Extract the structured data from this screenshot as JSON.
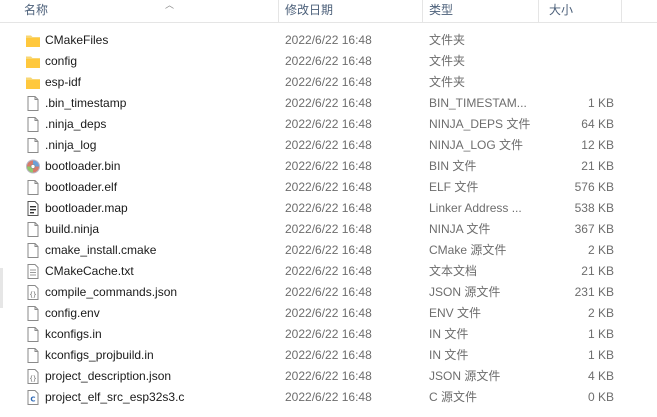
{
  "columns": {
    "name": "名称",
    "date": "修改日期",
    "type": "类型",
    "size": "大小"
  },
  "files": [
    {
      "name": "CMakeFiles",
      "date": "2022/6/22 16:48",
      "type": "文件夹",
      "size": "",
      "icon": "folder-icon"
    },
    {
      "name": "config",
      "date": "2022/6/22 16:48",
      "type": "文件夹",
      "size": "",
      "icon": "folder-icon"
    },
    {
      "name": "esp-idf",
      "date": "2022/6/22 16:48",
      "type": "文件夹",
      "size": "",
      "icon": "folder-icon"
    },
    {
      "name": ".bin_timestamp",
      "date": "2022/6/22 16:48",
      "type": "BIN_TIMESTAM...",
      "size": "1 KB",
      "icon": "file-icon"
    },
    {
      "name": ".ninja_deps",
      "date": "2022/6/22 16:48",
      "type": "NINJA_DEPS 文件",
      "size": "64 KB",
      "icon": "file-icon"
    },
    {
      "name": ".ninja_log",
      "date": "2022/6/22 16:48",
      "type": "NINJA_LOG 文件",
      "size": "12 KB",
      "icon": "file-icon"
    },
    {
      "name": "bootloader.bin",
      "date": "2022/6/22 16:48",
      "type": "BIN 文件",
      "size": "21 KB",
      "icon": "disc-bin-icon"
    },
    {
      "name": "bootloader.elf",
      "date": "2022/6/22 16:48",
      "type": "ELF 文件",
      "size": "576 KB",
      "icon": "file-icon"
    },
    {
      "name": "bootloader.map",
      "date": "2022/6/22 16:48",
      "type": "Linker Address ...",
      "size": "538 KB",
      "icon": "map-file-icon"
    },
    {
      "name": "build.ninja",
      "date": "2022/6/22 16:48",
      "type": "NINJA 文件",
      "size": "367 KB",
      "icon": "file-icon"
    },
    {
      "name": "cmake_install.cmake",
      "date": "2022/6/22 16:48",
      "type": "CMake 源文件",
      "size": "2 KB",
      "icon": "file-icon"
    },
    {
      "name": "CMakeCache.txt",
      "date": "2022/6/22 16:48",
      "type": "文本文档",
      "size": "21 KB",
      "icon": "text-file-icon"
    },
    {
      "name": "compile_commands.json",
      "date": "2022/6/22 16:48",
      "type": "JSON 源文件",
      "size": "231 KB",
      "icon": "json-file-icon"
    },
    {
      "name": "config.env",
      "date": "2022/6/22 16:48",
      "type": "ENV 文件",
      "size": "2 KB",
      "icon": "file-icon"
    },
    {
      "name": "kconfigs.in",
      "date": "2022/6/22 16:48",
      "type": "IN 文件",
      "size": "1 KB",
      "icon": "file-icon"
    },
    {
      "name": "kconfigs_projbuild.in",
      "date": "2022/6/22 16:48",
      "type": "IN 文件",
      "size": "1 KB",
      "icon": "file-icon"
    },
    {
      "name": "project_description.json",
      "date": "2022/6/22 16:48",
      "type": "JSON 源文件",
      "size": "4 KB",
      "icon": "json-file-icon"
    },
    {
      "name": "project_elf_src_esp32s3.c",
      "date": "2022/6/22 16:48",
      "type": "C 源文件",
      "size": "0 KB",
      "icon": "c-file-icon"
    }
  ]
}
